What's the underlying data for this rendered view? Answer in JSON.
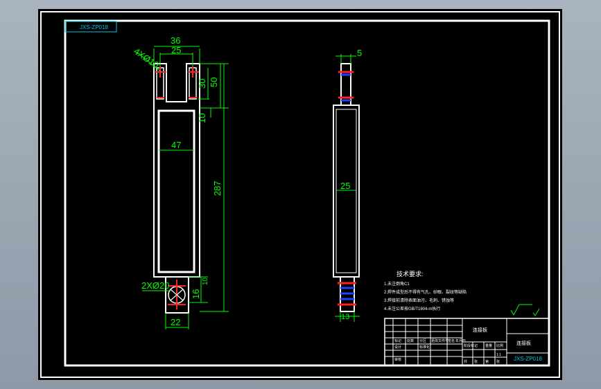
{
  "drawing_number": "JXS-ZP018",
  "dimensions": {
    "top_width": "36",
    "slot_spacing": "25",
    "holes_top": "4XØ10",
    "slot_length": "30",
    "fork_height": "50",
    "web_thickness": "10",
    "inner_width": "47",
    "total_length": "287",
    "holes_bottom": "2XØ20",
    "lug_height": "16",
    "lug_small": "10",
    "bottom_width": "22",
    "side_thickness": "5",
    "side_width": "25",
    "side_bottom": "13"
  },
  "notes": {
    "title": "技术要求:",
    "lines": [
      "1.未注倒角C1",
      "2.焊件成型后不得有气孔、砂眼、裂纹等缺陷",
      "3.焊接前清除表面油污、毛刺、锈蚀等",
      "4.未注公差按GB/T1804-m执行"
    ]
  },
  "title_block": {
    "part_code": "JXS-ZP018",
    "part_name": "连接板",
    "scale": "1:1",
    "headers": [
      "标记",
      "处数",
      "分区",
      "更改文件号",
      "签名",
      "年月日"
    ],
    "row2": [
      "设计",
      "",
      "标准化",
      "",
      "阶段标记",
      "重量",
      "比例"
    ],
    "row3": [
      "审核",
      "",
      "",
      "",
      "共",
      "张",
      "第",
      "张"
    ]
  },
  "roughness": "√(√)"
}
